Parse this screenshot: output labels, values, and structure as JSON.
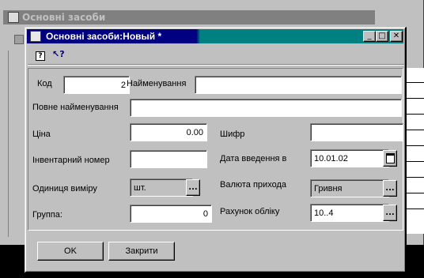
{
  "background_window": {
    "title": "Основні засоби"
  },
  "dialog": {
    "title": "Основні засоби:Новый *",
    "controls": {
      "minimize": "_",
      "maximize": "□",
      "close": "✕"
    }
  },
  "toolbar": {
    "help_glyph": "?",
    "whats_this_glyph": "↖?"
  },
  "form": {
    "code_label": "Код",
    "code_value": "2",
    "name_label": "Найменування",
    "name_value": "",
    "full_name_label": "Повне найменування",
    "full_name_value": "",
    "price_label": "Ціна",
    "price_value": "0.00",
    "cipher_label": "Шифр",
    "cipher_value": "",
    "inventory_label": "Інвентарний номер",
    "inventory_value": "",
    "date_label": "Дата введення в",
    "date_value": "10.01.02",
    "unit_label": "Одиниця виміру",
    "unit_value": "шт.",
    "currency_label": "Валюта прихода",
    "currency_value": "Гривня",
    "group_label": "Группа:",
    "group_value": "0",
    "account_label": "Рахунок обліку",
    "account_value": "10..4",
    "lookup_glyph": "..."
  },
  "buttons": {
    "ok_label": "OK",
    "close_label": "Закрити"
  }
}
